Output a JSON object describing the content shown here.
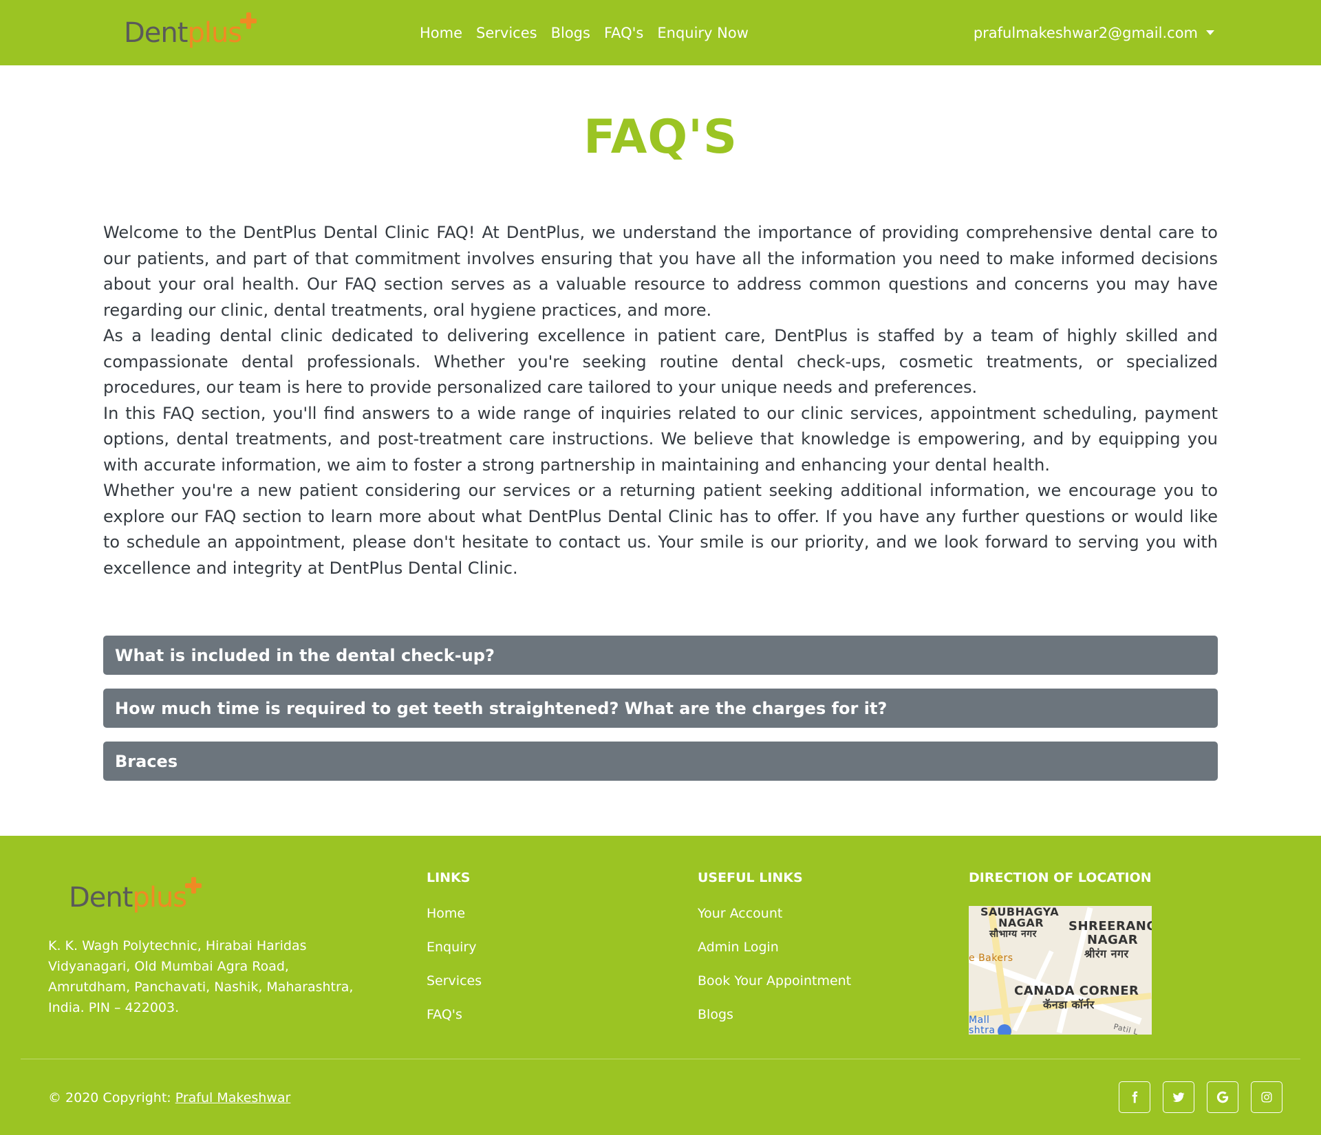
{
  "navbar": {
    "brand_dent": "Dent",
    "brand_plus": "plus",
    "links": [
      "Home",
      "Services",
      "Blogs",
      "FAQ's",
      "Enquiry Now"
    ],
    "user_email": "prafulmakeshwar2@gmail.com"
  },
  "page": {
    "title": "FAQ'S",
    "intro": [
      "Welcome to the DentPlus Dental Clinic FAQ! At DentPlus, we understand the importance of providing comprehensive dental care to our patients, and part of that commitment involves ensuring that you have all the information you need to make informed decisions about your oral health. Our FAQ section serves as a valuable resource to address common questions and concerns you may have regarding our clinic, dental treatments, oral hygiene practices, and more.",
      "As a leading dental clinic dedicated to delivering excellence in patient care, DentPlus is staffed by a team of highly skilled and compassionate dental professionals. Whether you're seeking routine dental check-ups, cosmetic treatments, or specialized procedures, our team is here to provide personalized care tailored to your unique needs and preferences.",
      "In this FAQ section, you'll find answers to a wide range of inquiries related to our clinic services, appointment scheduling, payment options, dental treatments, and post-treatment care instructions. We believe that knowledge is empowering, and by equipping you with accurate information, we aim to foster a strong partnership in maintaining and enhancing your dental health.",
      "Whether you're a new patient considering our services or a returning patient seeking additional information, we encourage you to explore our FAQ section to learn more about what DentPlus Dental Clinic has to offer. If you have any further questions or would like to schedule an appointment, please don't hesitate to contact us. Your smile is our priority, and we look forward to serving you with excellence and integrity at DentPlus Dental Clinic."
    ],
    "faqs": [
      "What is included in the dental check-up?",
      "How much time is required to get teeth straightened? What are the charges for it?",
      "Braces"
    ]
  },
  "footer": {
    "address": "K. K. Wagh Polytechnic, Hirabai Haridas Vidyanagari, Old Mumbai Agra Road, Amrutdham, Panchavati, Nashik, Maharashtra, India. PIN – 422003.",
    "links_heading": "LINKS",
    "links": [
      "Home",
      "Enquiry",
      "Services",
      "FAQ's"
    ],
    "useful_heading": "USEFUL LINKS",
    "useful_links": [
      "Your Account",
      "Admin Login",
      "Book Your Appointment",
      "Blogs"
    ],
    "direction_heading": "DIRECTION OF LOCATION",
    "map_labels": {
      "saubhagya": "SAUBHAGYA",
      "nagar1": "NAGAR",
      "saubhagya_hi": "सौभाग्य नगर",
      "shreerang": "SHREERANG",
      "nagar2": "NAGAR",
      "shreerang_hi": "श्रीरंग नगर",
      "bakers": "e Bakers",
      "canada": "CANADA CORNER",
      "canada_hi": "कॅनडा कॉर्नर",
      "mall": "Mall",
      "shtra": "shtra",
      "patil": "Patil L"
    },
    "copyright_prefix": "© 2020 Copyright: ",
    "copyright_name": "Praful Makeshwar",
    "socials": [
      "facebook-icon",
      "twitter-icon",
      "google-icon",
      "instagram-icon"
    ]
  },
  "colors": {
    "brand_green": "#9bc423",
    "brand_orange": "#f08a24",
    "faq_gray": "#6c757d"
  }
}
